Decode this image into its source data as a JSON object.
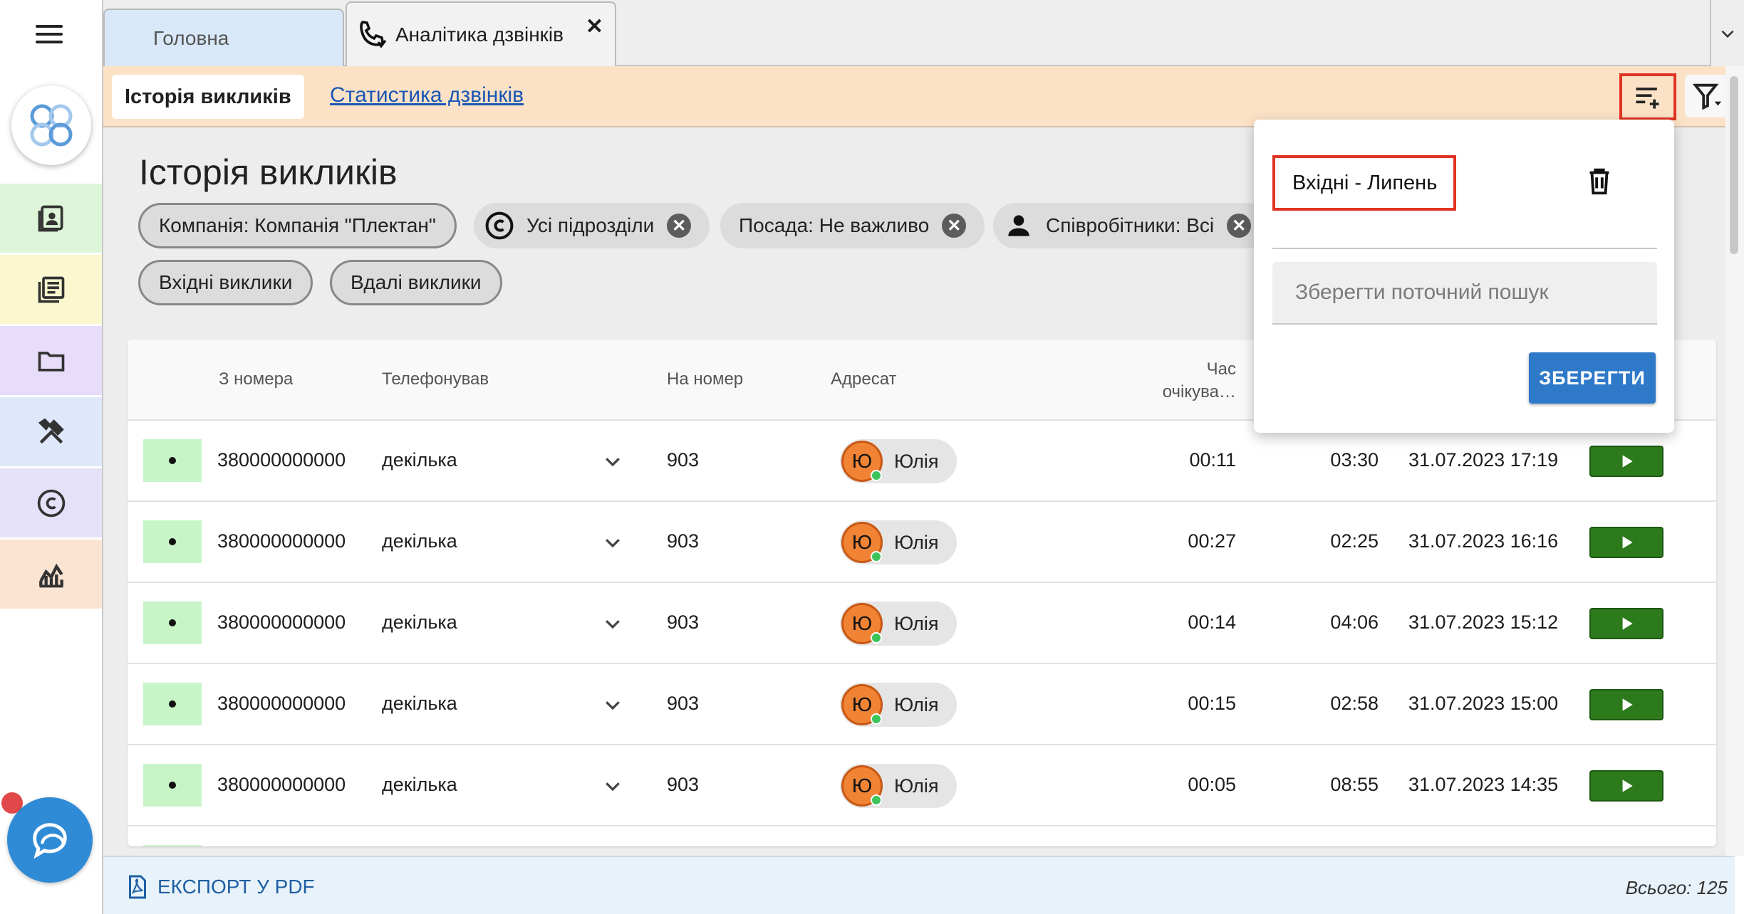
{
  "tabs": {
    "home_label": "Головна",
    "active_label": "Аналітика дзвінків",
    "close_symbol": "✕"
  },
  "subtabs": {
    "active_label": "Історія викликів",
    "link_label": "Статистика дзвінків"
  },
  "page": {
    "title": "Історія викликів"
  },
  "filters": {
    "company": "Компанія: Компанія \"Плектан\"",
    "divisions": "Усі підрозділи",
    "position": "Посада: Не важливо",
    "employees": "Співробітники: Всі",
    "incoming": "Вхідні виклики",
    "successful": "Вдалі виклики"
  },
  "table": {
    "headers": {
      "from_number": "З номера",
      "caller": "Телефонував",
      "to_number": "На номер",
      "addressee": "Адресат",
      "wait_time": "Час очікува…"
    },
    "rows": [
      {
        "from": "380000000000",
        "caller": "декілька",
        "to": "903",
        "avatar_letter": "Ю",
        "addressee": "Юлія",
        "wait": "00:11",
        "duration": "03:30",
        "datetime": "31.07.2023 17:19"
      },
      {
        "from": "380000000000",
        "caller": "декілька",
        "to": "903",
        "avatar_letter": "Ю",
        "addressee": "Юлія",
        "wait": "00:27",
        "duration": "02:25",
        "datetime": "31.07.2023 16:16"
      },
      {
        "from": "380000000000",
        "caller": "декілька",
        "to": "903",
        "avatar_letter": "Ю",
        "addressee": "Юлія",
        "wait": "00:14",
        "duration": "04:06",
        "datetime": "31.07.2023 15:12"
      },
      {
        "from": "380000000000",
        "caller": "декілька",
        "to": "903",
        "avatar_letter": "Ю",
        "addressee": "Юлія",
        "wait": "00:15",
        "duration": "02:58",
        "datetime": "31.07.2023 15:00"
      },
      {
        "from": "380000000000",
        "caller": "декілька",
        "to": "903",
        "avatar_letter": "Ю",
        "addressee": "Юлія",
        "wait": "00:05",
        "duration": "08:55",
        "datetime": "31.07.2023 14:35"
      }
    ]
  },
  "footer": {
    "export_label": "ЕКСПОРТ У PDF",
    "total": "Всього: 125"
  },
  "popup": {
    "saved_search": "Вхідні - Липень",
    "input_placeholder": "Зберегти поточний пошук",
    "save_label": "ЗБЕРЕГТИ"
  },
  "icons": {
    "menu": "hamburger-icon",
    "contacts": "contacts-icon",
    "news": "news-icon",
    "folder": "folder-icon",
    "tools": "tools-icon",
    "copyright": "copyright-icon",
    "analytics": "analytics-icon",
    "chat": "chat-icon",
    "phone": "phone-icon",
    "saved_filters": "saved-filters-icon",
    "filter": "filter-icon",
    "trash": "trash-icon",
    "pdf": "pdf-icon",
    "play": "play-icon"
  },
  "colors": {
    "subbar_bg": "#fbe2c6",
    "home_tab_bg": "#d8e8f8",
    "highlight_red": "#e03324",
    "save_button": "#2f79c9",
    "play_button": "#2c7a1c",
    "avatar_orange": "#f08434",
    "status_green": "#c8f5c8",
    "nav_contacts": "#dff5d9",
    "nav_news": "#fbf7cf",
    "nav_folder": "#e7dcfa",
    "nav_tools": "#dfe8fa",
    "nav_copyright": "#e4e1f8",
    "nav_analytics": "#fbe5d2"
  }
}
